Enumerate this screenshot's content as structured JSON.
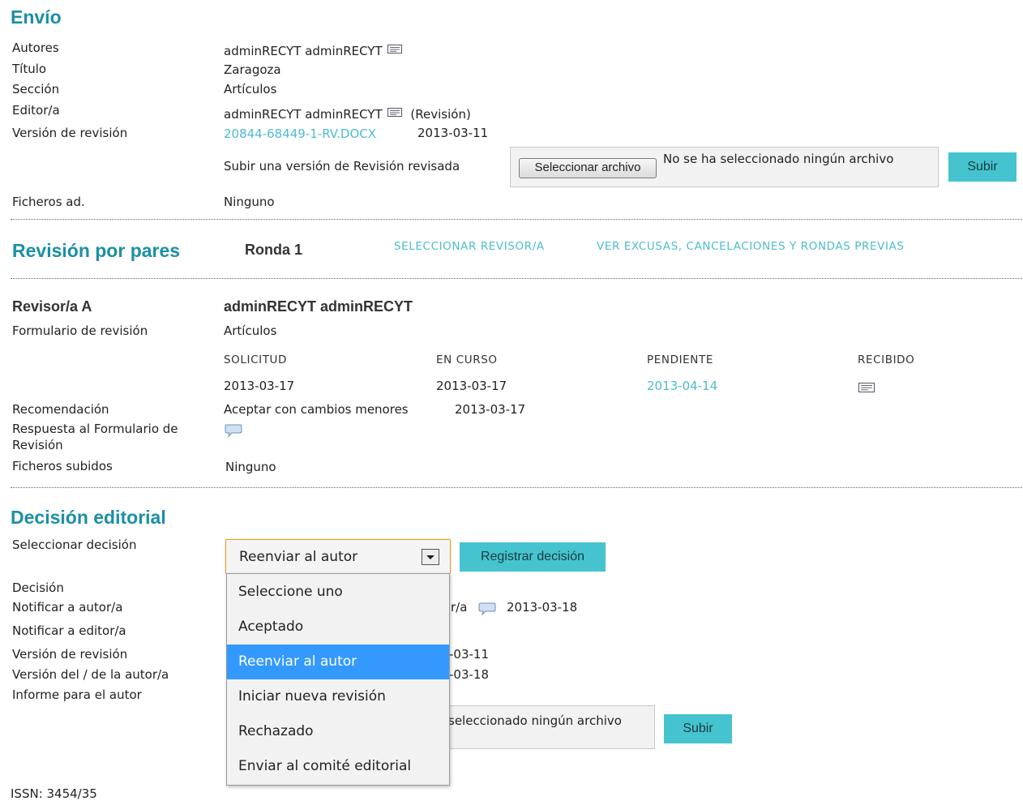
{
  "envio": {
    "title": "Envío",
    "autores_label": "Autores",
    "autores_value": "adminRECYT adminRECYT",
    "titulo_label": "Título",
    "titulo_value": "Zaragoza",
    "seccion_label": "Sección",
    "seccion_value": "Artículos",
    "editor_label": "Editor/a",
    "editor_value": "adminRECYT adminRECYT",
    "editor_suffix": "(Revisión)",
    "version_label": "Versión de revisión",
    "version_file": "20844-68449-1-RV.DOCX",
    "version_date": "2013-03-11",
    "upload_label": "Subir una versión de Revisión revisada",
    "file_button": "Seleccionar archivo",
    "file_status": "No se ha seleccionado ningún archivo",
    "submit": "Subir",
    "ficheros_label": "Ficheros ad.",
    "ficheros_value": "Ninguno"
  },
  "peer": {
    "title": "Revisión por pares",
    "round": "Ronda 1",
    "link_select": "SELECCIONAR REVISOR/A",
    "link_excuses": "VER EXCUSAS, CANCELACIONES Y RONDAS PREVIAS",
    "reviewer_label": "Revisor/a A",
    "reviewer_name": "adminRECYT adminRECYT",
    "form_label": "Formulario de revisión",
    "form_value": "Artículos",
    "col_solicitud": "SOLICITUD",
    "col_encurso": "EN CURSO",
    "col_pendiente": "PENDIENTE",
    "col_recibido": "RECIBIDO",
    "date_solicitud": "2013-03-17",
    "date_encurso": "2013-03-17",
    "date_pendiente": "2013-04-14",
    "recomendacion_label": "Recomendación",
    "recomendacion_value": "Aceptar con cambios menores",
    "recomendacion_date": "2013-03-17",
    "respuesta_label_1": "Respuesta al Formulario de",
    "respuesta_label_2": "Revisión",
    "subidos_label": "Ficheros subidos",
    "subidos_value": "Ninguno"
  },
  "decision": {
    "title": "Decisión editorial",
    "select_label": "Seleccionar decisión",
    "selected": "Reenviar al autor",
    "register_button": "Registrar decisión",
    "decision_label": "Decisión",
    "notify_author_label": "Notificar a autor/a",
    "notify_author_tail": "r/a",
    "notify_author_date": "2013-03-18",
    "notify_editor_label": "Notificar a editor/a",
    "rev_version_label": "Versión de revisión",
    "rev_version_tail": "-03-11",
    "author_version_label": "Versión del / de la autor/a",
    "author_version_tail": "-03-18",
    "report_label": "Informe para el autor",
    "file_status_tail": "seleccionado ningún archivo",
    "submit": "Subir",
    "options": [
      "Seleccione uno",
      "Aceptado",
      "Reenviar al autor",
      "Iniciar nueva revisión",
      "Rechazado",
      "Enviar al comité editorial"
    ]
  },
  "footer": {
    "issn": "ISSN: 3454/35"
  }
}
